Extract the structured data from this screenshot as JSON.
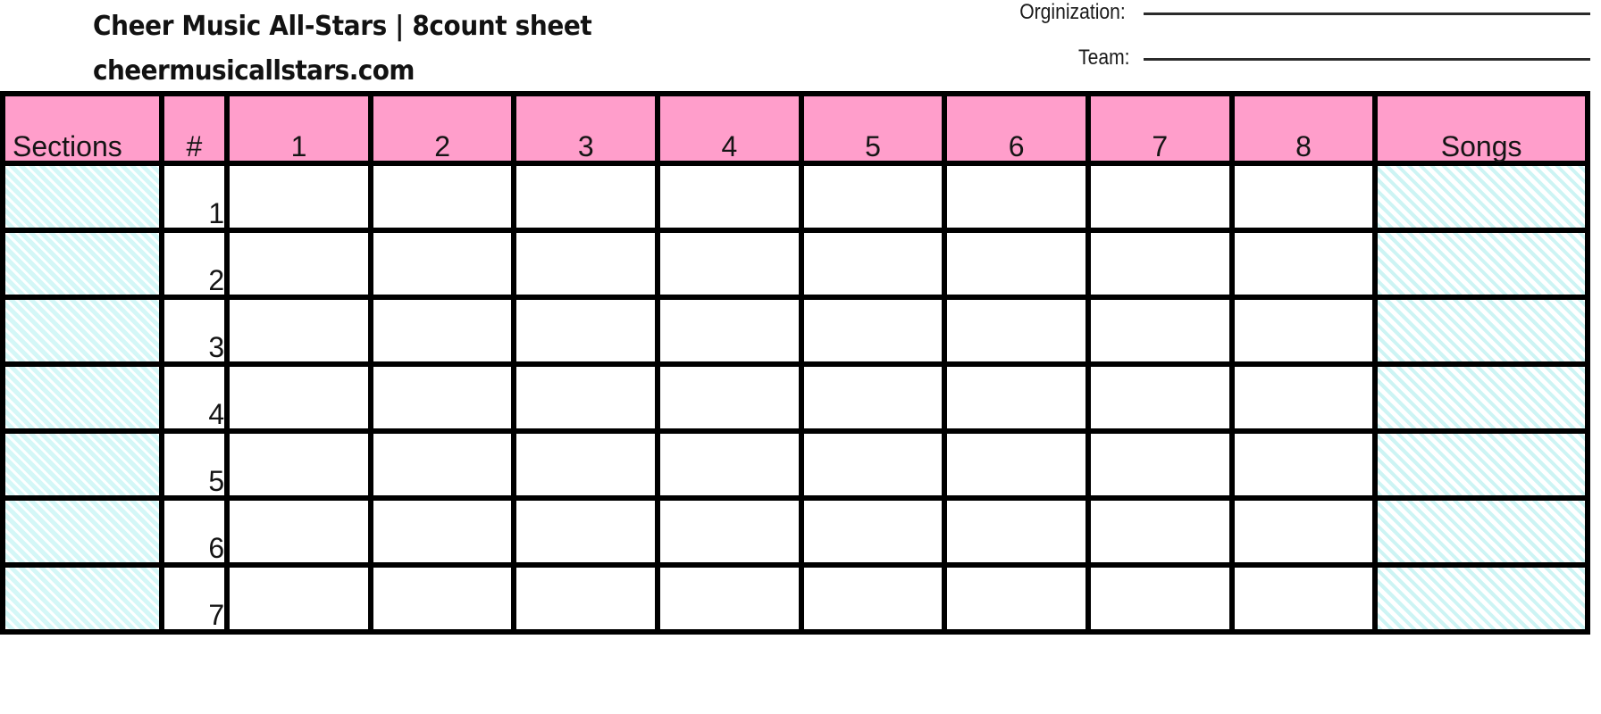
{
  "document": {
    "title_line": "Cheer Music All-Stars | 8count sheet",
    "website": "cheermusicallstars.com"
  },
  "fields": [
    {
      "label": "Orginization:",
      "value": ""
    },
    {
      "label": "Team:",
      "value": ""
    }
  ],
  "table": {
    "headers": {
      "sections": "Sections",
      "number": "#",
      "counts": [
        "1",
        "2",
        "3",
        "4",
        "5",
        "6",
        "7",
        "8"
      ],
      "songs": "Songs"
    },
    "rows": [
      {
        "section": "",
        "number": "1",
        "counts": [
          "",
          "",
          "",
          "",
          "",
          "",
          "",
          ""
        ],
        "song": ""
      },
      {
        "section": "",
        "number": "2",
        "counts": [
          "",
          "",
          "",
          "",
          "",
          "",
          "",
          ""
        ],
        "song": ""
      },
      {
        "section": "",
        "number": "3",
        "counts": [
          "",
          "",
          "",
          "",
          "",
          "",
          "",
          ""
        ],
        "song": ""
      },
      {
        "section": "",
        "number": "4",
        "counts": [
          "",
          "",
          "",
          "",
          "",
          "",
          "",
          ""
        ],
        "song": ""
      },
      {
        "section": "",
        "number": "5",
        "counts": [
          "",
          "",
          "",
          "",
          "",
          "",
          "",
          ""
        ],
        "song": ""
      },
      {
        "section": "",
        "number": "6",
        "counts": [
          "",
          "",
          "",
          "",
          "",
          "",
          "",
          ""
        ],
        "song": ""
      },
      {
        "section": "",
        "number": "7",
        "counts": [
          "",
          "",
          "",
          "",
          "",
          "",
          "",
          ""
        ],
        "song": ""
      }
    ]
  },
  "colors": {
    "header_pink": "#ff9ecb",
    "hatch_cyan": "#cdf4f4",
    "border_black": "#000000",
    "text_black": "#151515"
  }
}
